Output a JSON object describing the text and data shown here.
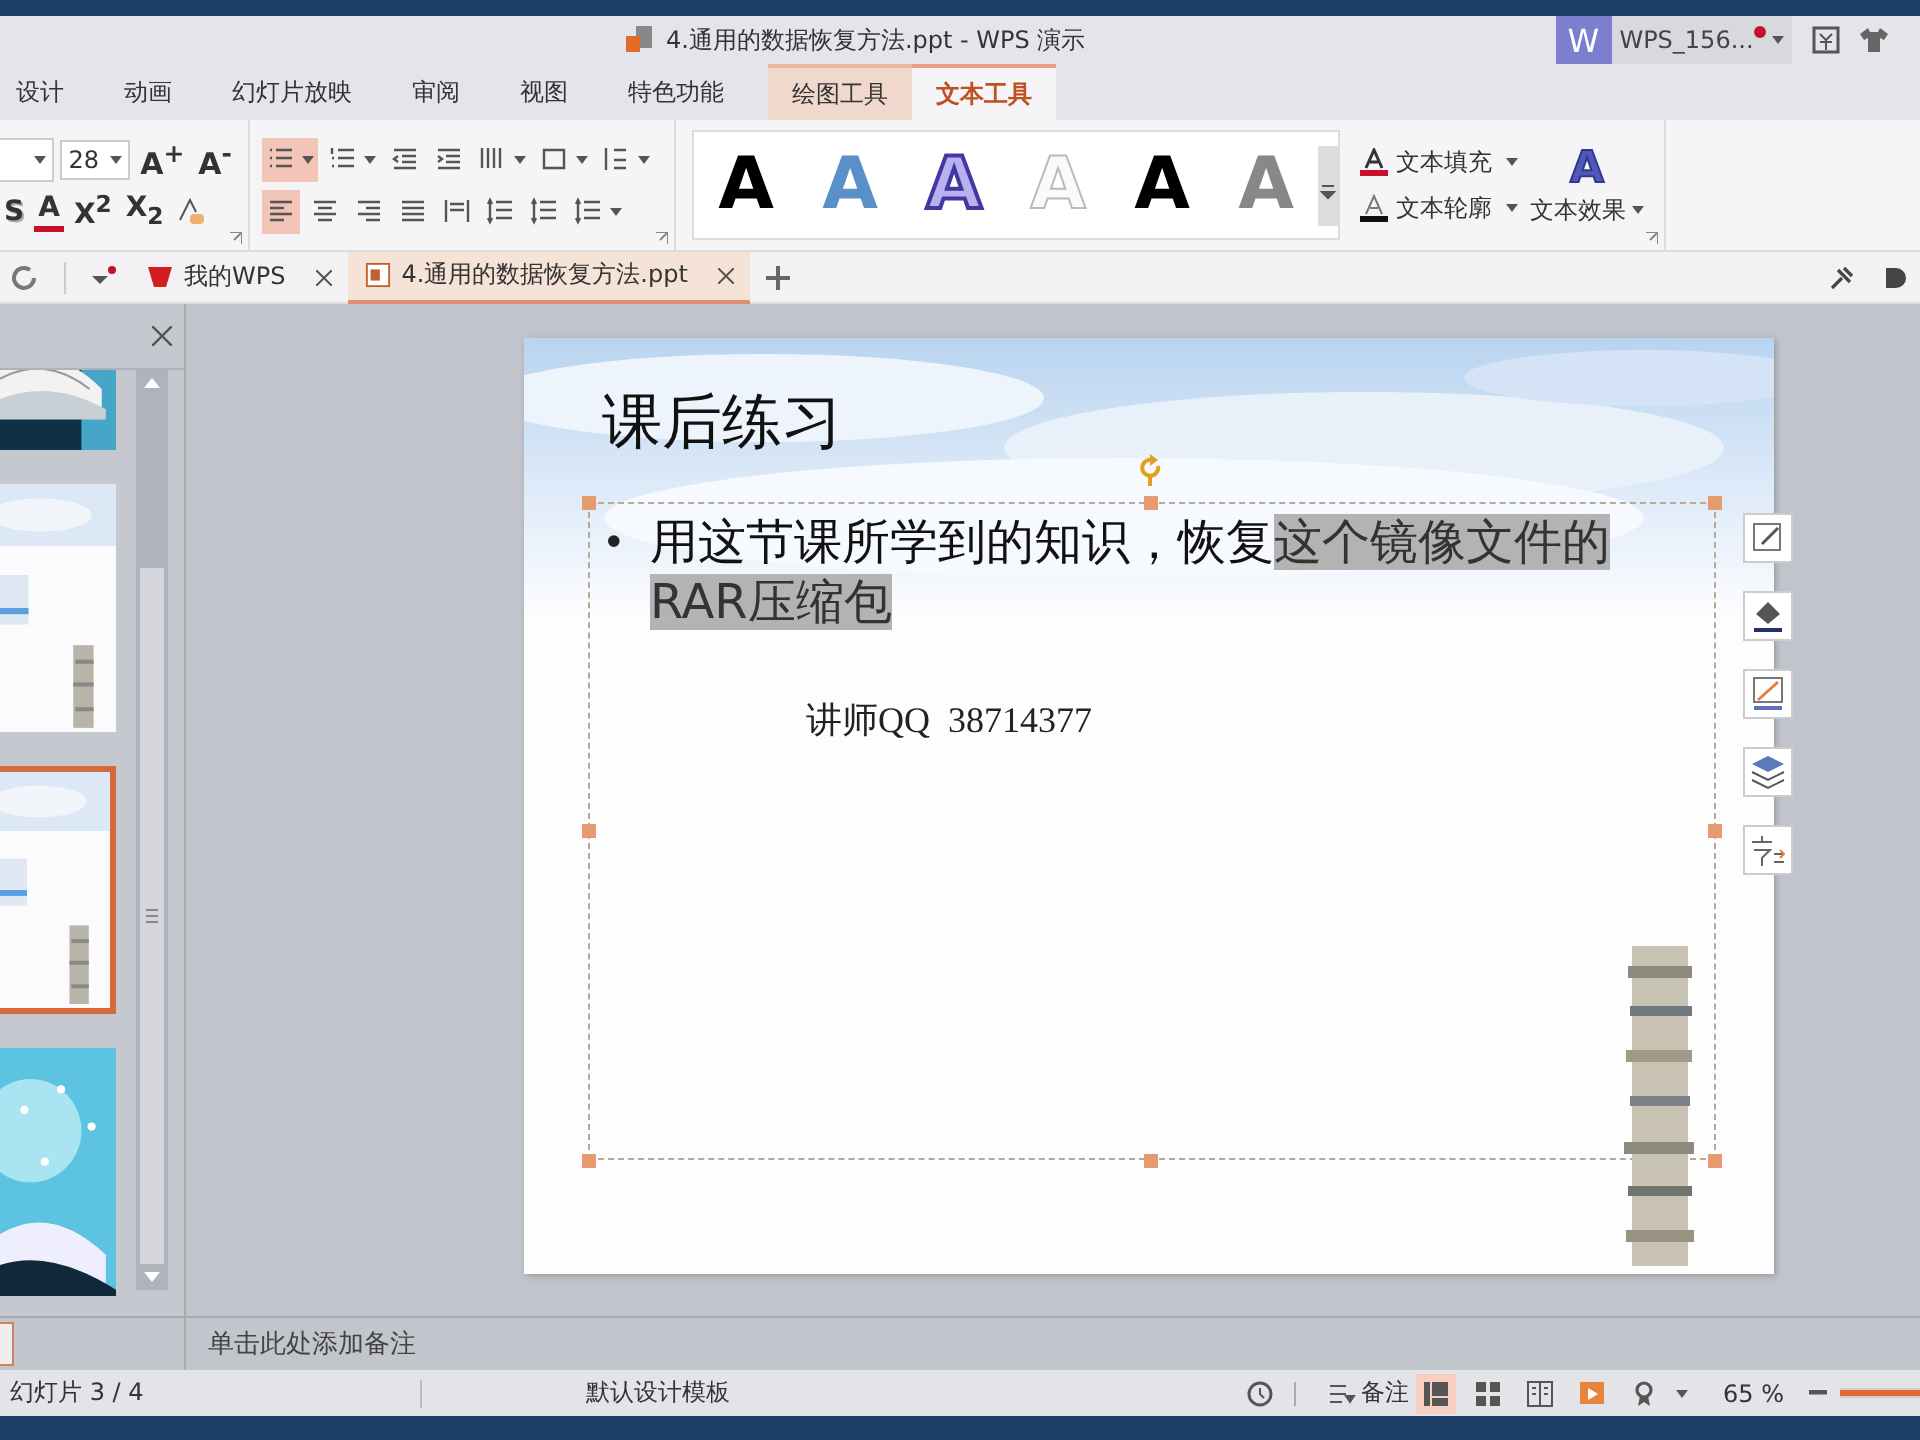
{
  "window": {
    "title": "4.通用的数据恢复方法.ppt - WPS 演示",
    "account_badge": "W",
    "account": "WPS_156..."
  },
  "ribbon_tabs": [
    {
      "label": "设计",
      "selected": false,
      "contextual": false
    },
    {
      "label": "动画",
      "selected": false,
      "contextual": false
    },
    {
      "label": "幻灯片放映",
      "selected": false,
      "contextual": false
    },
    {
      "label": "审阅",
      "selected": false,
      "contextual": false
    },
    {
      "label": "视图",
      "selected": false,
      "contextual": false
    },
    {
      "label": "特色功能",
      "selected": false,
      "contextual": false
    },
    {
      "label": "绘图工具",
      "selected": false,
      "contextual": true
    },
    {
      "label": "文本工具",
      "selected": true,
      "contextual": true
    }
  ],
  "toolbar": {
    "font_size": "28",
    "size_buttons": [
      "A$^{+}$",
      "A$^{-}$"
    ],
    "font_buttons": [
      {
        "label": "S",
        "kind": "shadow"
      },
      {
        "label": "A",
        "kind": "color"
      },
      {
        "label": "X$^{2}$",
        "kind": "plain"
      },
      {
        "label": "X$_{2}$",
        "kind": "plain"
      }
    ],
    "paragraph_row1": [
      {
        "kind": "bullets",
        "selected": true,
        "dropdown": true
      },
      {
        "kind": "numbering",
        "selected": false,
        "dropdown": true
      },
      {
        "kind": "outdent",
        "selected": false,
        "dropdown": false
      },
      {
        "kind": "indent",
        "selected": false,
        "dropdown": false
      },
      {
        "kind": "columns",
        "selected": false,
        "dropdown": true
      },
      {
        "kind": "box",
        "selected": false,
        "dropdown": true
      },
      {
        "kind": "direction",
        "selected": false,
        "dropdown": true
      }
    ],
    "paragraph_row2": [
      {
        "kind": "align-left",
        "selected": true,
        "dropdown": false
      },
      {
        "kind": "align-center",
        "selected": false,
        "dropdown": false
      },
      {
        "kind": "align-right",
        "selected": false,
        "dropdown": false
      },
      {
        "kind": "justify",
        "selected": false,
        "dropdown": false
      },
      {
        "kind": "distribute",
        "selected": false,
        "dropdown": false
      },
      {
        "kind": "spacing",
        "selected": false,
        "dropdown": false
      },
      {
        "kind": "spacing",
        "selected": false,
        "dropdown": false
      },
      {
        "kind": "spacing",
        "selected": false,
        "dropdown": true
      }
    ],
    "text_styles": [
      {
        "letter": "A",
        "kind": "solid"
      },
      {
        "letter": "A",
        "kind": "blue"
      },
      {
        "letter": "A",
        "kind": "outline"
      },
      {
        "letter": "A",
        "kind": "ghost"
      },
      {
        "letter": "A",
        "kind": "solid"
      },
      {
        "letter": "A",
        "kind": "gradient"
      }
    ],
    "text_fill": "文本填充",
    "text_outline": "文本轮廓",
    "effect_letter": "A",
    "text_effect": "文本效果"
  },
  "doc_tabs": [
    {
      "label": "我的WPS",
      "selected": false
    },
    {
      "label": "4.通用的数据恢复方法.ppt",
      "selected": true
    }
  ],
  "thumbnails": [
    {
      "kind": "book",
      "selected": false
    },
    {
      "kind": "slide",
      "selected": false
    },
    {
      "kind": "slide",
      "selected": true
    },
    {
      "kind": "stars",
      "selected": false
    }
  ],
  "slide": {
    "title": "课后练习",
    "bullet": "•",
    "bullet_text": "用这节课所学到的知识，恢复",
    "bullet_selected_text": "这个镜像文件的RAR压缩包",
    "note": "讲师QQ  38714377"
  },
  "notes_placeholder": "单击此处添加备注",
  "status_bar": {
    "slide_counter": "幻灯片 3 / 4",
    "template": "默认设计模板",
    "notes_button": "备注",
    "zoom": "65 %",
    "zoom_slider": {
      "level": 1
    }
  }
}
